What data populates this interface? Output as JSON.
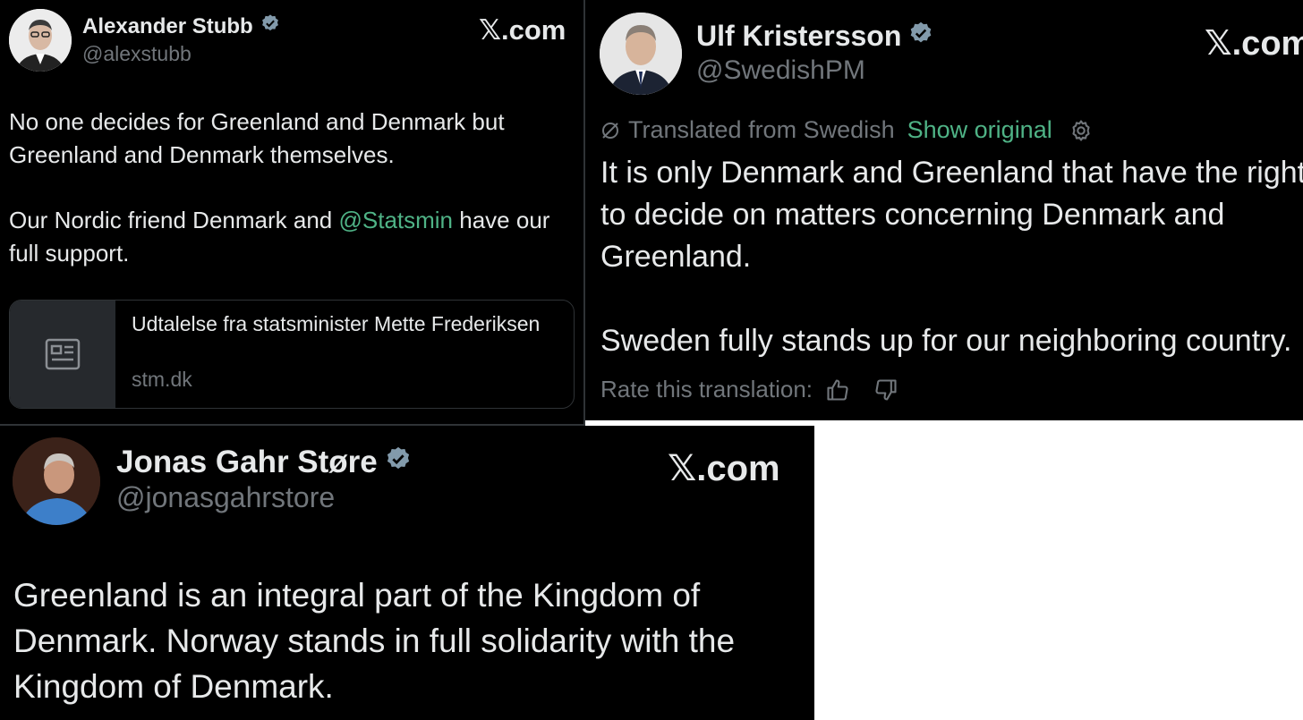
{
  "posts": [
    {
      "display_name": "Alexander Stubb",
      "handle": "@alexstubb",
      "site_x": "𝕏",
      "site_com": ".com",
      "body_line1": "No one decides for Greenland and Denmark but Greenland and Denmark themselves.",
      "body_line2_pre": "Our Nordic friend Denmark and ",
      "body_line2_mention": "@Statsmin",
      "body_line2_post": " have our full support.",
      "link_card": {
        "title": "Udtalelse fra statsminister Mette Frederiksen",
        "domain": "stm.dk",
        "icon": "article-icon"
      }
    },
    {
      "display_name": "Ulf Kristersson",
      "handle": "@SwedishPM",
      "site_x": "𝕏",
      "site_com": ".com",
      "translated_label": "Translated from Swedish",
      "show_original": "Show original",
      "body_line1": "It is only Denmark and Greenland that have the right to decide on matters concerning Denmark and Greenland.",
      "body_line2": "Sweden fully stands up for our neighboring country.",
      "rate_label": "Rate this translation:"
    },
    {
      "display_name": "Jonas Gahr Støre",
      "handle": "@jonasgahrstore",
      "site_x": "𝕏",
      "site_com": ".com",
      "body": "Greenland is an integral part of the Kingdom of Denmark. Norway stands in full solidarity with the Kingdom of Denmark."
    }
  ],
  "colors": {
    "background": "#000000",
    "text": "#e7e9ea",
    "secondary": "#71767b",
    "accent": "#4fb386",
    "verified": "#829aab"
  }
}
